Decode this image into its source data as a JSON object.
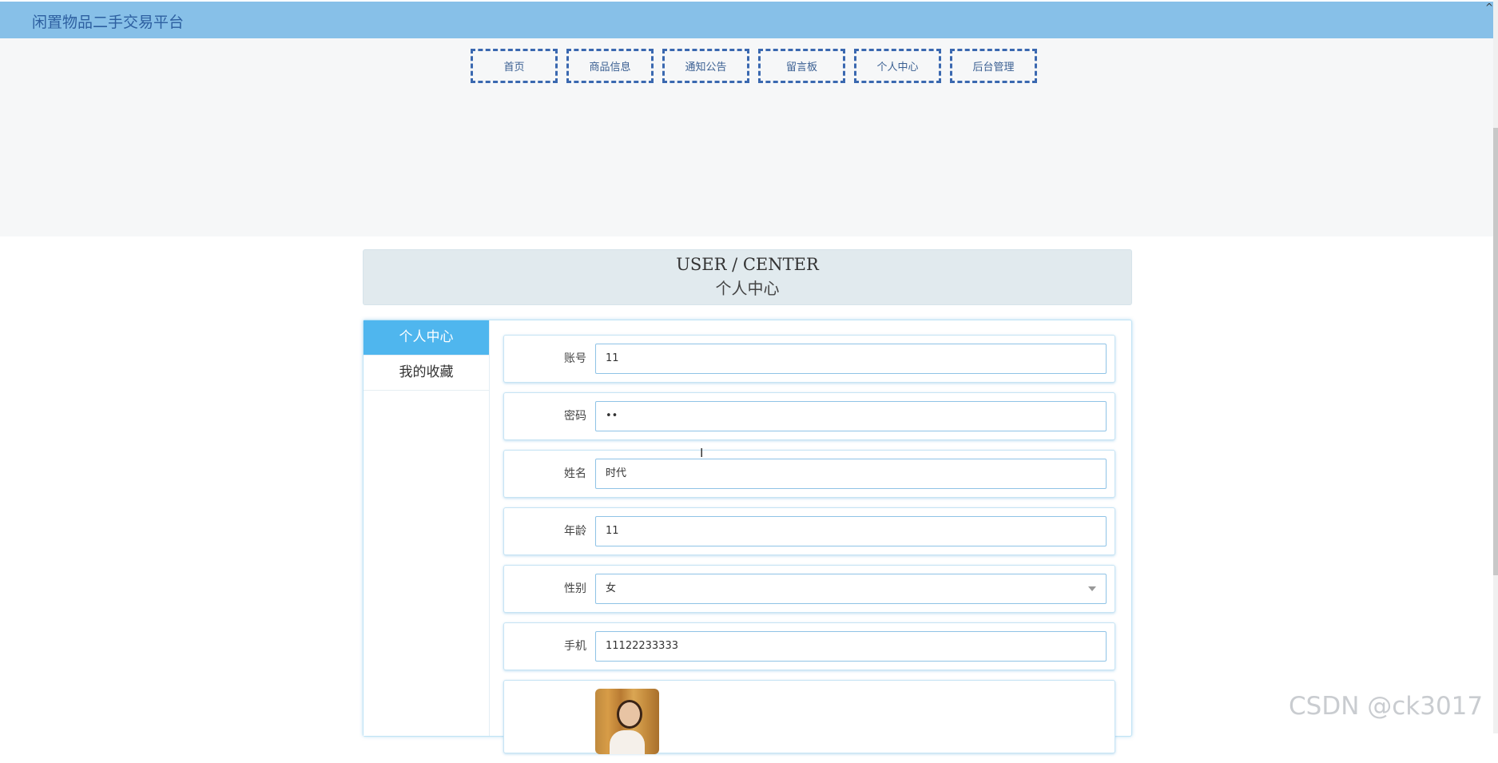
{
  "header": {
    "title": "闲置物品二手交易平台",
    "corner": "^"
  },
  "nav": {
    "items": [
      "首页",
      "商品信息",
      "通知公告",
      "留言板",
      "个人中心",
      "后台管理"
    ]
  },
  "user_center": {
    "title_en": "USER / CENTER",
    "title_cn": "个人中心"
  },
  "sidebar": {
    "tabs": [
      "个人中心",
      "我的收藏"
    ],
    "active_tab": "个人中心"
  },
  "form": {
    "account": {
      "label": "账号",
      "value": "11"
    },
    "password": {
      "label": "密码",
      "value": "••"
    },
    "name": {
      "label": "姓名",
      "value": "时代"
    },
    "age": {
      "label": "年龄",
      "value": "11"
    },
    "gender": {
      "label": "性别",
      "value": "女"
    },
    "phone": {
      "label": "手机",
      "value": "11122233333"
    }
  },
  "cursor": "I",
  "watermark": "CSDN @ck3017",
  "colors": {
    "topbar": "#87c0e8",
    "active_tab": "#4fb6ee",
    "nav_border": "#3a68b0"
  }
}
